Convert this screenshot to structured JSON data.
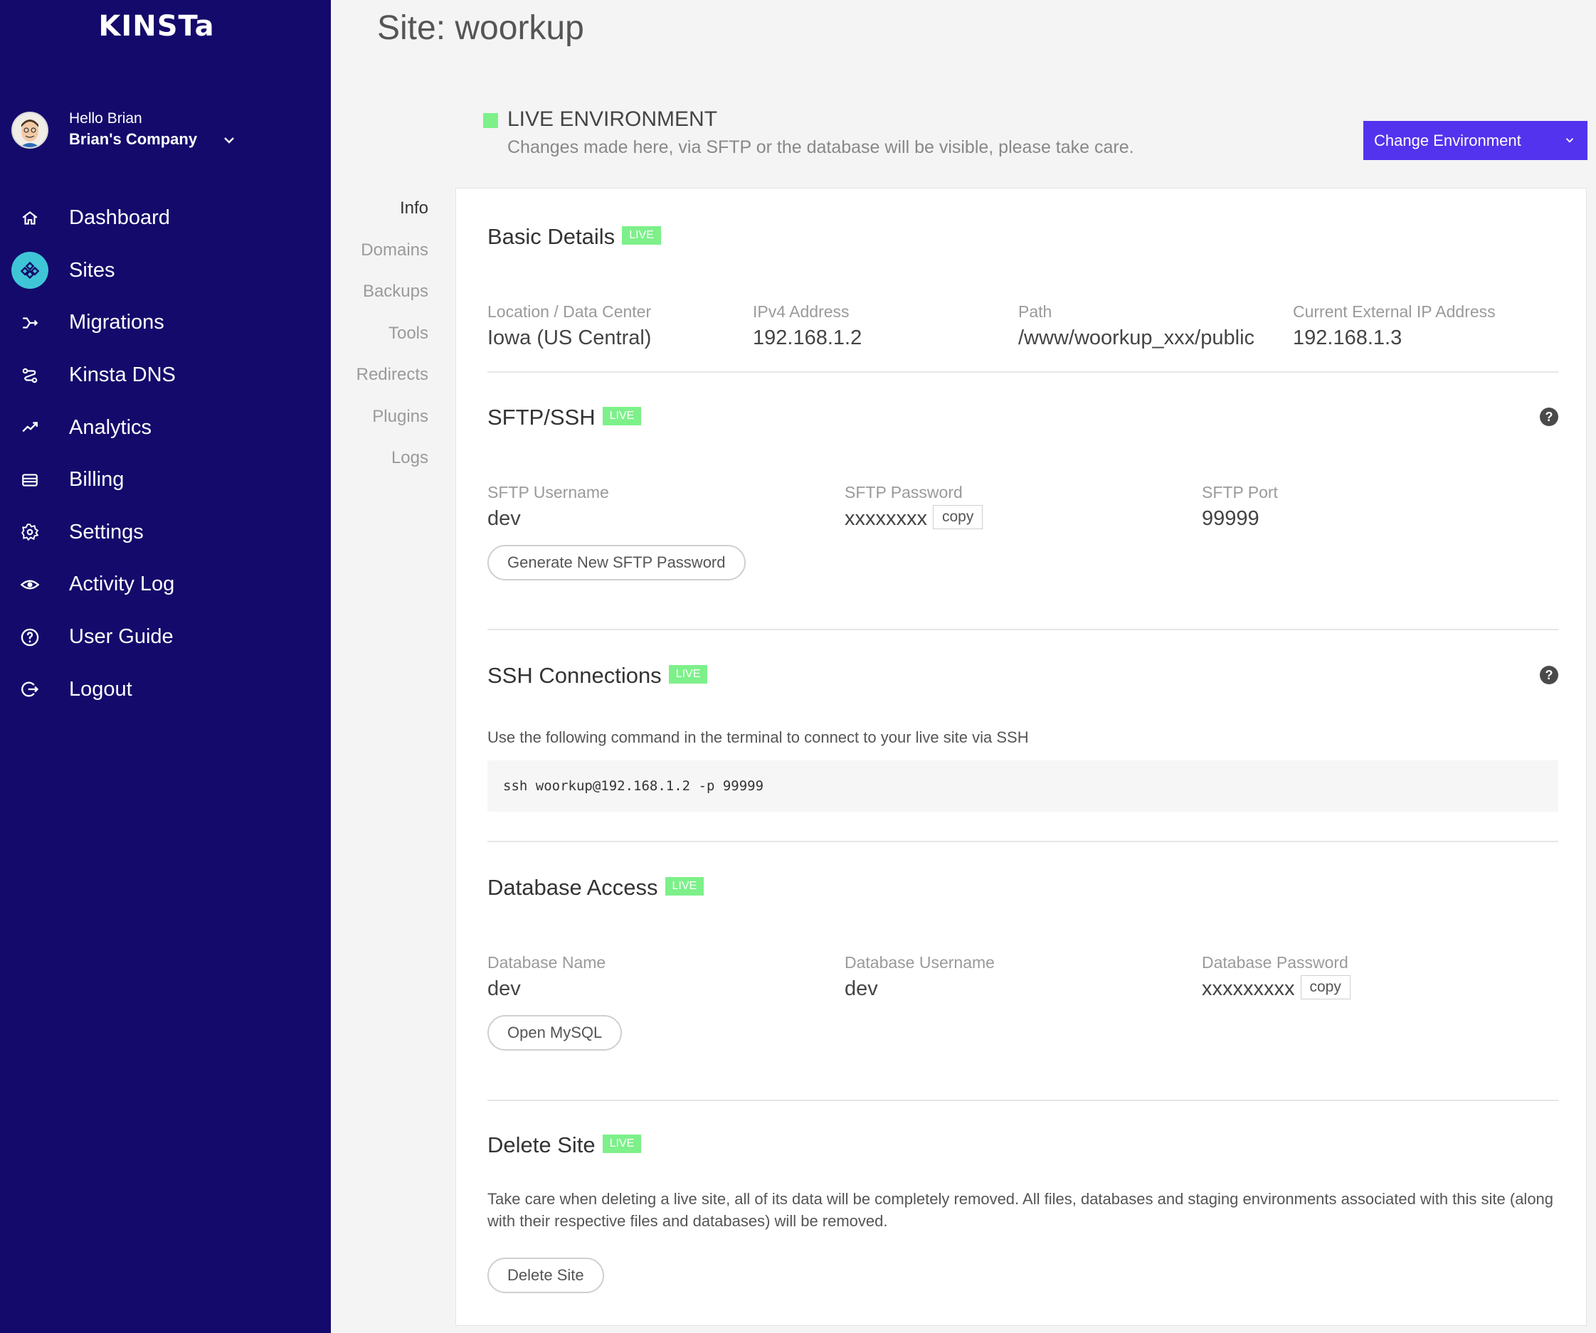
{
  "brand": {
    "logo_text": "KINSTa"
  },
  "user": {
    "greeting": "Hello Brian",
    "company": "Brian's Company"
  },
  "nav": [
    {
      "label": "Dashboard",
      "icon": "home-icon"
    },
    {
      "label": "Sites",
      "icon": "sites-icon",
      "active": true
    },
    {
      "label": "Migrations",
      "icon": "migrations-icon"
    },
    {
      "label": "Kinsta DNS",
      "icon": "dns-icon"
    },
    {
      "label": "Analytics",
      "icon": "analytics-icon"
    },
    {
      "label": "Billing",
      "icon": "billing-icon"
    },
    {
      "label": "Settings",
      "icon": "gear-icon"
    },
    {
      "label": "Activity Log",
      "icon": "eye-icon"
    },
    {
      "label": "User Guide",
      "icon": "question-icon"
    },
    {
      "label": "Logout",
      "icon": "logout-icon"
    }
  ],
  "page": {
    "title": "Site: woorkup"
  },
  "environment": {
    "title": "LIVE ENVIRONMENT",
    "description": "Changes made here, via SFTP or the database will be visible, please take care.",
    "change_button": "Change Environment",
    "indicator_color": "#7df08a"
  },
  "subnav": [
    "Info",
    "Domains",
    "Backups",
    "Tools",
    "Redirects",
    "Plugins",
    "Logs"
  ],
  "badge": "LIVE",
  "basic_details": {
    "title": "Basic Details",
    "fields": [
      {
        "label": "Location / Data Center",
        "value": "Iowa (US Central)"
      },
      {
        "label": "IPv4 Address",
        "value": "192.168.1.2"
      },
      {
        "label": "Path",
        "value": "/www/woorkup_xxx/public"
      },
      {
        "label": "Current External IP Address",
        "value": "192.168.1.3"
      }
    ]
  },
  "sftp": {
    "title": "SFTP/SSH",
    "fields": [
      {
        "label": "SFTP Username",
        "value": "dev"
      },
      {
        "label": "SFTP Password",
        "value": "xxxxxxxx"
      },
      {
        "label": "SFTP Port",
        "value": "99999"
      }
    ],
    "copy_label": "copy",
    "button": "Generate New SFTP Password"
  },
  "ssh": {
    "title": "SSH Connections",
    "description": "Use the following command in the terminal to connect to your live site via SSH",
    "command": "ssh woorkup@192.168.1.2 -p 99999"
  },
  "database": {
    "title": "Database Access",
    "fields": [
      {
        "label": "Database Name",
        "value": "dev"
      },
      {
        "label": "Database Username",
        "value": "dev"
      },
      {
        "label": "Database Password",
        "value": "xxxxxxxxx"
      }
    ],
    "copy_label": "copy",
    "button": "Open MySQL"
  },
  "delete": {
    "title": "Delete Site",
    "description": "Take care when deleting a live site, all of its data will be completely removed. All files, databases and staging environments associated with this site (along with their respective files and databases) will be removed.",
    "button": "Delete Site"
  },
  "colors": {
    "sidebar": "#140a6b",
    "accent": "#5333ed",
    "live_badge": "#7df08a",
    "active_nav_icon": "#3ec6d6"
  }
}
